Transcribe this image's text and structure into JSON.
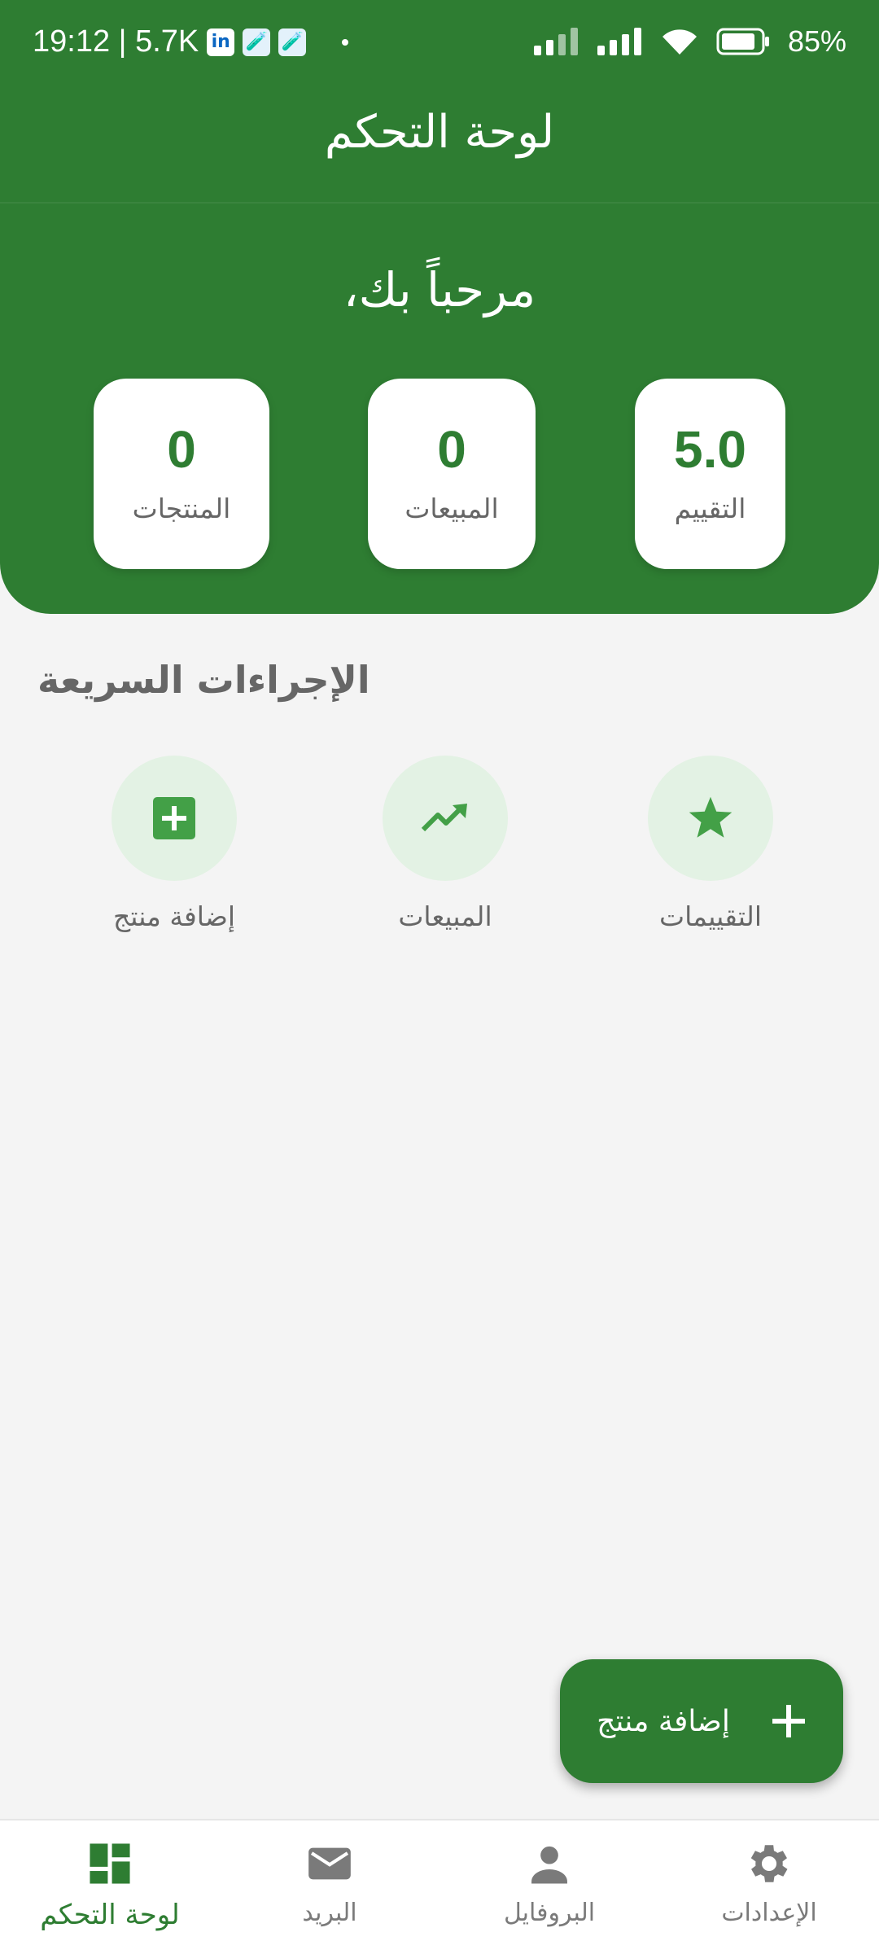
{
  "status_bar": {
    "time": "19:12 | 5.7K",
    "apps": [
      "in",
      "🧪",
      "🧪"
    ],
    "battery": "85%"
  },
  "header": {
    "title": "لوحة التحكم",
    "welcome": "مرحباً بك،"
  },
  "stats": [
    {
      "value": "5.0",
      "label": "التقييم"
    },
    {
      "value": "0",
      "label": "المبيعات"
    },
    {
      "value": "0",
      "label": "المنتجات"
    }
  ],
  "quick_actions": {
    "title": "الإجراءات السريعة",
    "items": [
      {
        "label": "التقييمات",
        "icon": "star-icon"
      },
      {
        "label": "المبيعات",
        "icon": "trending-up-icon"
      },
      {
        "label": "إضافة منتج",
        "icon": "add-box-icon"
      }
    ]
  },
  "fab": {
    "label": "إضافة منتج",
    "icon": "plus-icon"
  },
  "bottom_nav": [
    {
      "label": "الإعدادات",
      "icon": "gear-icon",
      "active": false
    },
    {
      "label": "البروفايل",
      "icon": "person-icon",
      "active": false
    },
    {
      "label": "البريد",
      "icon": "mail-icon",
      "active": false
    },
    {
      "label": "لوحة التحكم",
      "icon": "dashboard-icon",
      "active": true
    }
  ],
  "colors": {
    "primary": "#2e7d32",
    "accent": "#43a047",
    "action_bg": "#e3f2e4",
    "background": "#f4f4f4"
  }
}
